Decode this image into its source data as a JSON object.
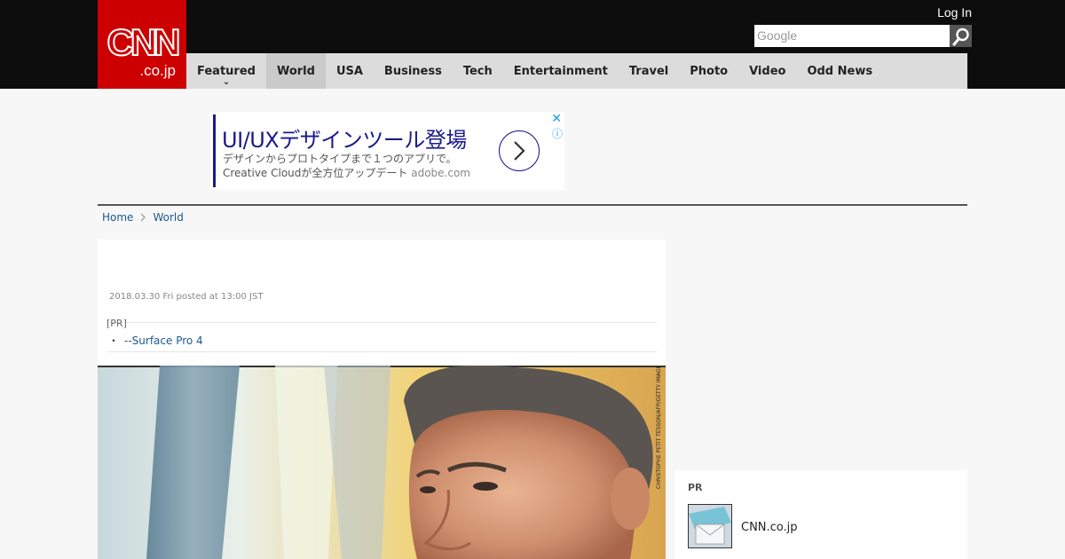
{
  "header": {
    "logo_main": "CNN",
    "logo_sub": ".co.jp",
    "login": "Log In",
    "search_placeholder": "Google",
    "nav": [
      {
        "label": "Featured"
      },
      {
        "label": "World"
      },
      {
        "label": "USA"
      },
      {
        "label": "Business"
      },
      {
        "label": "Tech"
      },
      {
        "label": "Entertainment"
      },
      {
        "label": "Travel"
      },
      {
        "label": "Photo"
      },
      {
        "label": "Video"
      },
      {
        "label": "Odd News"
      }
    ],
    "active_nav": "World",
    "brand_color": "#cc0000"
  },
  "ad": {
    "title": "UI/UXデザインツール登場",
    "line1": "デザインからプロトタイプまで１つのアプリで。",
    "line2": "Creative Cloudが全方位アップデート",
    "domain": "adobe.com",
    "close": "✕",
    "info": "ⓘ"
  },
  "breadcrumb": {
    "items": [
      "Home",
      "World"
    ]
  },
  "article": {
    "posted": "2018.03.30 Fri posted at 13:00 JST",
    "pr_label": "[PR]",
    "pr_link": "--Surface Pro 4",
    "photo_credit": "CHRISTOPHE PETIT TESSON/AFP/GETTY IMAGES"
  },
  "sidebar": {
    "pr_label": "PR",
    "item_text": "CNN.co.jp"
  }
}
